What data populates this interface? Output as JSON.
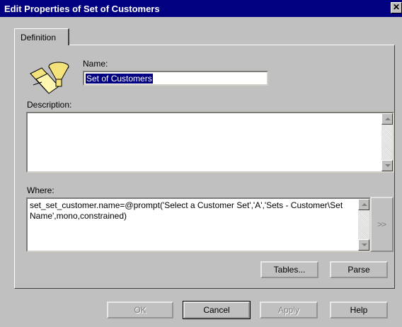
{
  "window": {
    "title": "Edit Properties of Set of Customers",
    "close_glyph": "✕"
  },
  "tabs": [
    {
      "label": "Definition"
    }
  ],
  "icon": {
    "name": "set-customers-icon",
    "color": "#f4e27a"
  },
  "name_field": {
    "label": "Name:",
    "value": "Set of Customers"
  },
  "description_field": {
    "label": "Description:",
    "value": ""
  },
  "where_field": {
    "label": "Where:",
    "line1": "set_set_customer.name=@prompt('Select a Customer Set','A','Sets - Customer\\Set",
    "line2": "Name',mono,constrained)",
    "expand_glyph": ">>"
  },
  "buttons": {
    "tables": "Tables...",
    "parse": "Parse",
    "ok": "OK",
    "cancel": "Cancel",
    "apply": "Apply",
    "help": "Help"
  },
  "colors": {
    "titlebar": "#000080",
    "dialog": "#c0c0c0",
    "selection": "#000080"
  }
}
